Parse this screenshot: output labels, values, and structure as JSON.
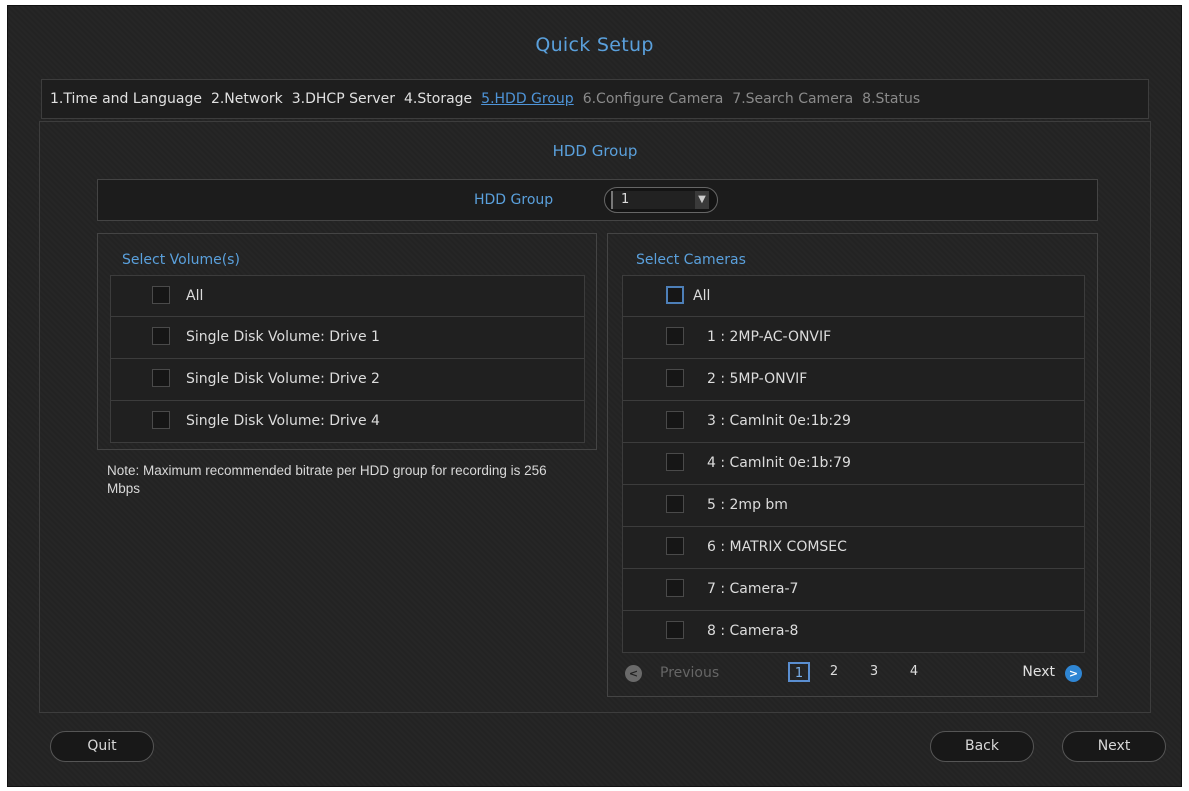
{
  "window": {
    "title": "Quick Setup"
  },
  "steps": [
    {
      "label": "1.Time and Language",
      "state": "done"
    },
    {
      "label": "2.Network",
      "state": "done"
    },
    {
      "label": "3.DHCP Server",
      "state": "done"
    },
    {
      "label": "4.Storage",
      "state": "done"
    },
    {
      "label": "5.HDD Group",
      "state": "active"
    },
    {
      "label": "6.Configure Camera",
      "state": "disabled"
    },
    {
      "label": "7.Search Camera",
      "state": "disabled"
    },
    {
      "label": "8.Status",
      "state": "disabled"
    }
  ],
  "section": {
    "title": "HDD Group"
  },
  "hdd_group": {
    "label": "HDD Group",
    "selected": "1"
  },
  "volumes": {
    "title": "Select Volume(s)",
    "items": [
      {
        "label": "All",
        "checked": false
      },
      {
        "label": "Single Disk Volume: Drive 1",
        "checked": false
      },
      {
        "label": "Single Disk Volume: Drive 2",
        "checked": false
      },
      {
        "label": "Single Disk Volume: Drive 4",
        "checked": false
      }
    ]
  },
  "note": "Note: Maximum recommended bitrate per HDD group for recording is 256 Mbps",
  "cameras": {
    "title": "Select Cameras",
    "all_label": "All",
    "items": [
      {
        "label": "1 : 2MP-AC-ONVIF",
        "checked": false
      },
      {
        "label": "2 : 5MP-ONVIF",
        "checked": false
      },
      {
        "label": "3 : CamInit 0e:1b:29",
        "checked": false
      },
      {
        "label": "4 : CamInit 0e:1b:79",
        "checked": false
      },
      {
        "label": "5 : 2mp bm",
        "checked": false
      },
      {
        "label": "6 : MATRIX COMSEC",
        "checked": false
      },
      {
        "label": "7 : Camera-7",
        "checked": false
      },
      {
        "label": "8 : Camera-8",
        "checked": false
      }
    ]
  },
  "pager": {
    "prev_label": "Previous",
    "next_label": "Next",
    "prev_icon": "chevron-left-icon",
    "next_icon": "chevron-right-icon",
    "pages": [
      "1",
      "2",
      "3",
      "4"
    ],
    "current_page": "1"
  },
  "footer": {
    "quit_label": "Quit",
    "back_label": "Back",
    "next_label": "Next"
  },
  "colors": {
    "accent": "#5aa0dc",
    "background": "#262626",
    "active_step": "#4e94d8"
  }
}
